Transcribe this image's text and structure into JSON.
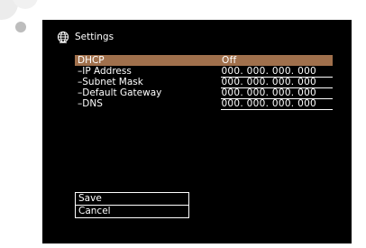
{
  "window": {
    "title": "Settings"
  },
  "settings": [
    {
      "label": "DHCP",
      "value": "Off"
    },
    {
      "label": "–IP Address",
      "value": "000. 000. 000. 000"
    },
    {
      "label": "–Subnet Mask",
      "value": "000. 000. 000. 000"
    },
    {
      "label": "–Default Gateway",
      "value": "000. 000. 000. 000"
    },
    {
      "label": "–DNS",
      "value": "000. 000. 000. 000"
    }
  ],
  "buttons": {
    "save": "Save",
    "cancel": "Cancel"
  },
  "colors": {
    "background": "#000000",
    "highlight": "#a0704c",
    "text": "#ffffff"
  },
  "icons": {
    "title": "globe-icon"
  }
}
